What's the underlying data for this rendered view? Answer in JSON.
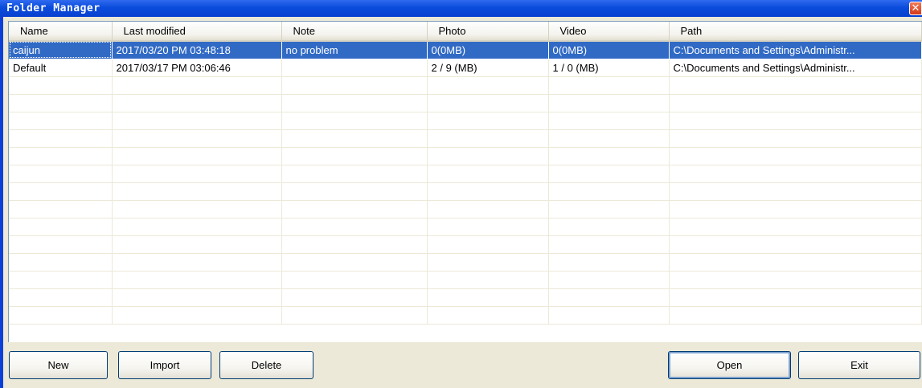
{
  "window": {
    "title": "Folder Manager",
    "close_glyph": "✕"
  },
  "table": {
    "columns": [
      "Name",
      "Last modified",
      "Note",
      "Photo",
      "Video",
      "Path"
    ],
    "rows": [
      {
        "name": "caijun",
        "last_modified": "2017/03/20 PM 03:48:18",
        "note": "no problem",
        "photo": "0(0MB)",
        "video": "0(0MB)",
        "path": "C:\\Documents and Settings\\Administr...",
        "selected": true
      },
      {
        "name": "Default",
        "last_modified": "2017/03/17 PM 03:06:46",
        "note": "",
        "photo": "2 / 9 (MB)",
        "video": "1 / 0 (MB)",
        "path": "C:\\Documents and Settings\\Administr...",
        "selected": false
      }
    ]
  },
  "buttons": {
    "new": "New",
    "import": "Import",
    "delete": "Delete",
    "open": "Open",
    "exit": "Exit"
  },
  "colors": {
    "titlebar": "#0b4cdc",
    "selection": "#316ac5",
    "window_face": "#ece9d8"
  }
}
